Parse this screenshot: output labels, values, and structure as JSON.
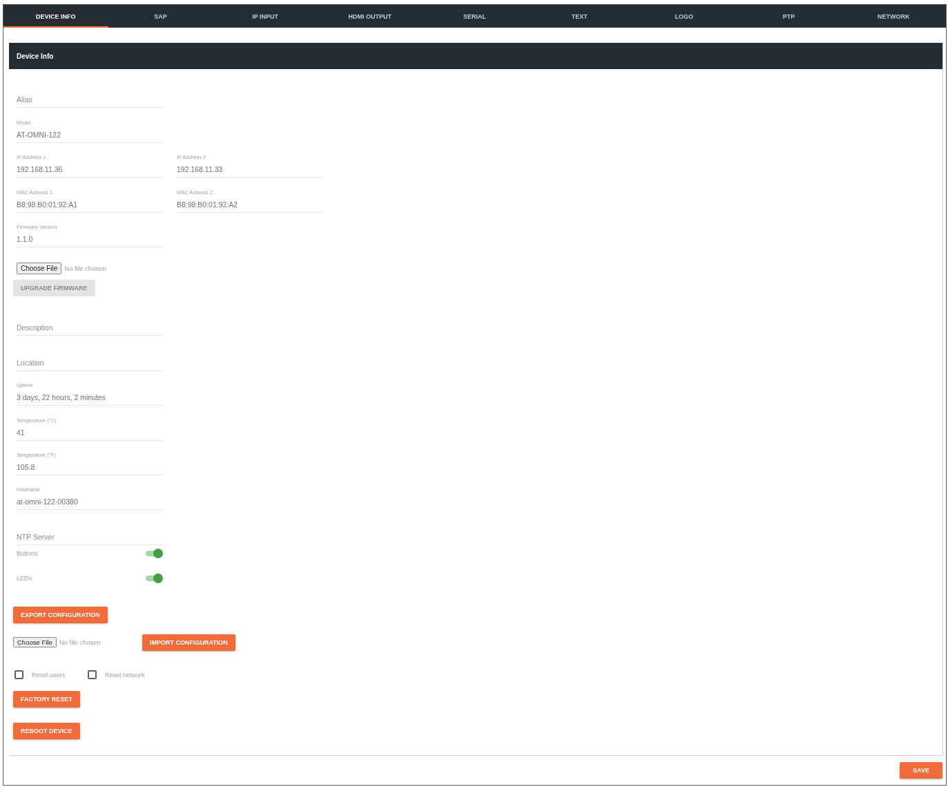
{
  "tabs": [
    {
      "label": "DEVICE INFO",
      "selected": true
    },
    {
      "label": "SAP",
      "selected": false
    },
    {
      "label": "IP INPUT",
      "selected": false
    },
    {
      "label": "HDMI OUTPUT",
      "selected": false
    },
    {
      "label": "SERIAL",
      "selected": false
    },
    {
      "label": "TEXT",
      "selected": false
    },
    {
      "label": "LOGO",
      "selected": false
    },
    {
      "label": "PTP",
      "selected": false
    },
    {
      "label": "NETWORK",
      "selected": false
    }
  ],
  "panel": {
    "title": "Device Info",
    "form": [
      {
        "kind": "fields",
        "fields": [
          {
            "placeholder": "Alias"
          }
        ]
      },
      {
        "kind": "fields",
        "fields": [
          {
            "label": "Model",
            "value": "AT-OMNI-122"
          }
        ]
      },
      {
        "kind": "fields",
        "fields": [
          {
            "label": "IP Address 1",
            "value": "192.168.11.36"
          },
          {
            "label": "IP Address 2",
            "value": "192.168.11.33"
          }
        ]
      },
      {
        "kind": "fields",
        "fields": [
          {
            "label": "MAC Address 1",
            "value": "B8:98:B0:01:92:A1"
          },
          {
            "label": "MAC Address 2",
            "value": "B8:98:B0:01:92:A2"
          }
        ]
      },
      {
        "kind": "fields",
        "fields": [
          {
            "label": "Firmware Version",
            "value": "1.1.0"
          }
        ]
      },
      {
        "kind": "file",
        "button": "Choose File",
        "status": "No file chosen"
      },
      {
        "kind": "button",
        "label": "UPGRADE FIRMWARE",
        "disabled": true
      },
      {
        "kind": "fields",
        "fields": [
          {
            "placeholder": "Description"
          }
        ]
      },
      {
        "kind": "fields",
        "fields": [
          {
            "placeholder": "Location"
          }
        ]
      },
      {
        "kind": "fields",
        "fields": [
          {
            "label": "Uptime",
            "value": "3 days, 22 hours, 2 minutes"
          }
        ]
      },
      {
        "kind": "fields",
        "fields": [
          {
            "label": "Temperature (°C)",
            "value": "41"
          }
        ]
      },
      {
        "kind": "fields",
        "fields": [
          {
            "label": "Temperature (°F)",
            "value": "105.8"
          }
        ]
      },
      {
        "kind": "fields",
        "fields": [
          {
            "label": "Hostname",
            "value": "at-omni-122-00380"
          }
        ]
      },
      {
        "kind": "fields",
        "fields": [
          {
            "placeholder": "NTP Server"
          }
        ]
      },
      {
        "kind": "toggle",
        "label": "Buttons",
        "on": true
      },
      {
        "kind": "toggle",
        "label": "LEDs",
        "on": true
      },
      {
        "kind": "button",
        "label": "EXPORT CONFIGURATION",
        "disabled": false
      },
      {
        "kind": "file",
        "button": "Choose File",
        "status": "No file chosen",
        "action": {
          "label": "IMPORT CONFIGURATION",
          "disabled": false
        }
      },
      {
        "kind": "checkboxes",
        "items": [
          {
            "label": "Reset users",
            "checked": false
          },
          {
            "label": "Reset network",
            "checked": false
          }
        ]
      },
      {
        "kind": "button",
        "label": "FACTORY RESET",
        "disabled": false
      },
      {
        "kind": "button",
        "label": "REBOOT DEVICE",
        "disabled": false
      }
    ]
  },
  "footer": {
    "save": {
      "label": "SAVE",
      "disabled": false
    }
  }
}
